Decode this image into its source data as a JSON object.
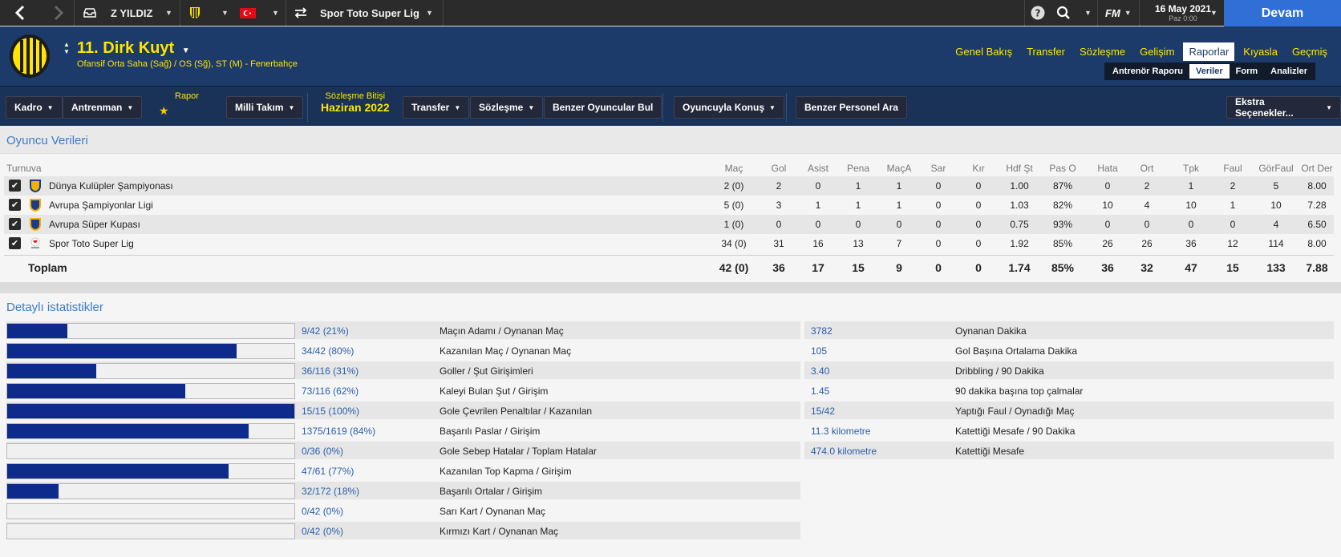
{
  "topbar": {
    "club_name": "Z YILDIZ",
    "league": "Spor Toto Super Lig",
    "game_logo": "FM",
    "date": "16 May 2021",
    "day_time": "Paz 0:00",
    "continue_label": "Devam"
  },
  "player": {
    "name": "11. Dirk Kuyt",
    "positions": "Ofansif Orta Saha (Sağ) / OS (Sğ), ST (M) - Fenerbahçe"
  },
  "nav": {
    "tabs": [
      {
        "label": "Genel Bakış"
      },
      {
        "label": "Transfer"
      },
      {
        "label": "Sözleşme"
      },
      {
        "label": "Gelişim"
      },
      {
        "label": "Raporlar"
      },
      {
        "label": "Kıyasla"
      },
      {
        "label": "Geçmiş"
      }
    ],
    "subtabs": [
      {
        "label": "Antrenör Raporu"
      },
      {
        "label": "Veriler"
      },
      {
        "label": "Form"
      },
      {
        "label": "Analizler"
      }
    ]
  },
  "toolbar": {
    "kadro": "Kadro",
    "antrenman": "Antrenman",
    "rapor_label": "Rapor",
    "milli_takim": "Milli Takım",
    "contract_label": "Sözleşme Bitişi",
    "contract_value": "Haziran 2022",
    "transfer": "Transfer",
    "sozlesme": "Sözleşme",
    "similar_players": "Benzer Oyuncular Bul",
    "talk": "Oyuncuyla Konuş",
    "similar_staff": "Benzer Personel Ara",
    "extra": "Ekstra Seçenekler..."
  },
  "player_data": {
    "title": "Oyuncu Verileri",
    "headers": [
      "Turnuva",
      "Maç",
      "Gol",
      "Asist",
      "Pena",
      "MaçA",
      "Sar",
      "Kır",
      "Hdf Şt",
      "Pas O",
      "Hata",
      "Ort",
      "Tpk",
      "Faul",
      "GörFaul",
      "Ort Der"
    ],
    "rows": [
      {
        "name": "Dünya Kulüpler Şampiyonası",
        "values": [
          "2 (0)",
          "2",
          "0",
          "1",
          "1",
          "0",
          "0",
          "1.00",
          "87%",
          "0",
          "2",
          "1",
          "2",
          "5",
          "8.00"
        ]
      },
      {
        "name": "Avrupa Şampiyonlar Ligi",
        "values": [
          "5 (0)",
          "3",
          "1",
          "1",
          "1",
          "0",
          "0",
          "1.03",
          "82%",
          "10",
          "4",
          "10",
          "1",
          "10",
          "7.28"
        ]
      },
      {
        "name": "Avrupa Süper Kupası",
        "values": [
          "1 (0)",
          "0",
          "0",
          "0",
          "0",
          "0",
          "0",
          "0.75",
          "93%",
          "0",
          "0",
          "0",
          "0",
          "4",
          "6.50"
        ]
      },
      {
        "name": "Spor Toto Super Lig",
        "values": [
          "34 (0)",
          "31",
          "16",
          "13",
          "7",
          "0",
          "0",
          "1.92",
          "85%",
          "26",
          "26",
          "36",
          "12",
          "114",
          "8.00"
        ]
      }
    ],
    "total": {
      "name": "Toplam",
      "values": [
        "42 (0)",
        "36",
        "17",
        "15",
        "9",
        "0",
        "0",
        "1.74",
        "85%",
        "36",
        "32",
        "47",
        "15",
        "133",
        "7.88"
      ]
    }
  },
  "detailed": {
    "title": "Detaylı istatistikler",
    "bars": [
      {
        "value": "9/42 (21%)",
        "label": "Maçın Adamı / Oynanan Maç",
        "fraction": 0.21
      },
      {
        "value": "34/42 (80%)",
        "label": "Kazanılan Maç / Oynanan Maç",
        "fraction": 0.8
      },
      {
        "value": "36/116 (31%)",
        "label": "Goller / Şut Girişimleri",
        "fraction": 0.31
      },
      {
        "value": "73/116 (62%)",
        "label": "Kaleyi Bulan Şut / Girişim",
        "fraction": 0.62
      },
      {
        "value": "15/15 (100%)",
        "label": "Gole Çevrilen Penaltılar / Kazanılan",
        "fraction": 1.0
      },
      {
        "value": "1375/1619 (84%)",
        "label": "Başarılı Paslar / Girişim",
        "fraction": 0.84
      },
      {
        "value": "0/36 (0%)",
        "label": "Gole Sebep Hatalar / Toplam Hatalar",
        "fraction": 0.0
      },
      {
        "value": "47/61 (77%)",
        "label": "Kazanılan Top Kapma / Girişim",
        "fraction": 0.77
      },
      {
        "value": "32/172 (18%)",
        "label": "Başarılı Ortalar / Girişim",
        "fraction": 0.18
      },
      {
        "value": "0/42 (0%)",
        "label": "Sarı Kart / Oynanan Maç",
        "fraction": 0.0
      },
      {
        "value": "0/42 (0%)",
        "label": "Kırmızı Kart / Oynanan Maç",
        "fraction": 0.0
      }
    ],
    "right": [
      {
        "value": "3782",
        "label": "Oynanan Dakika"
      },
      {
        "value": "105",
        "label": "Gol Başına Ortalama Dakika"
      },
      {
        "value": "3.40",
        "label": "Dribbling / 90 Dakika"
      },
      {
        "value": "1.45",
        "label": "90 dakika başına top çalmalar"
      },
      {
        "value": "15/42",
        "label": "Yaptığı Faul / Oynadığı Maç"
      },
      {
        "value": "11.3 kilometre",
        "label": "Katettiği Mesafe / 90 Dakika"
      },
      {
        "value": "474.0 kilometre",
        "label": "Katettiği Mesafe"
      }
    ]
  },
  "colors": {
    "accent": "#ffe500",
    "bar": "#0e2a8a",
    "link": "#2b5da8",
    "continue": "#2f6fd6"
  }
}
